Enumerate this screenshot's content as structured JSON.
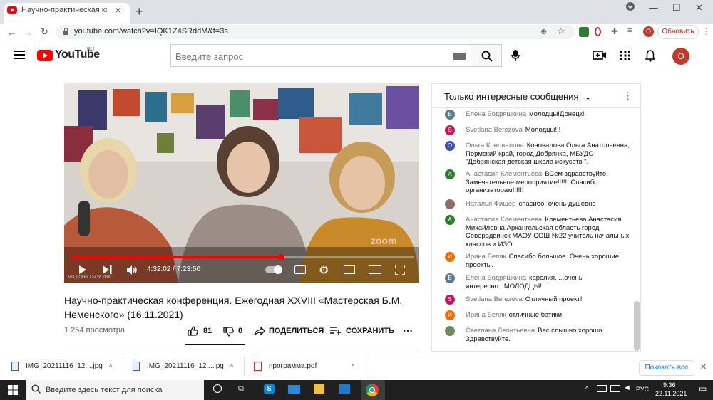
{
  "browser": {
    "tab_title": "Научно-практическая конфере",
    "url": "youtube.com/watch?v=IQK1Z4SRddM&t=3s",
    "update_label": "Обновить",
    "profile_initial": "О"
  },
  "youtube": {
    "logo_text": "YouTube",
    "region": "RU",
    "search_placeholder": "Введите запрос",
    "avatar_initial": "О"
  },
  "player": {
    "time_display": "4:32:02 / 7:23:50",
    "progress_fraction": 0.613,
    "watermark": "zoom",
    "corner_mark": "ГМЦ ДОНМ ГБОУ УНКО"
  },
  "video": {
    "title": "Научно-практическая конференция. Ежегодная XXVIII «Мастерская Б.М. Неменского» (16.11.2021)",
    "views": "1 254 просмотра",
    "likes": "81",
    "dislikes": "0",
    "share_label": "ПОДЕЛИТЬСЯ",
    "save_label": "СОХРАНИТЬ"
  },
  "chat": {
    "header": "Только интересные сообщения",
    "messages": [
      {
        "initial": "Е",
        "color": "#607d8b",
        "author": "Елена Бодряшкина",
        "text": "молодцы!Донецк!"
      },
      {
        "initial": "S",
        "color": "#c2185b",
        "author": "Svetlana Berezova",
        "text": "Молодцы!!!"
      },
      {
        "initial": "О",
        "color": "#3f51b5",
        "author": "Ольга Коновалова",
        "text": "Коновалова Ольга Анатольевна, Пермский край, город Добрянка, МБУДО \"Добрянская детская школа искусств \"."
      },
      {
        "initial": "А",
        "color": "#2e7d32",
        "author": "Анастасия Клементьева",
        "text": "ВСем здравствуйте. Замечательное мероприятие!!!!!! Спасибо организаторам!!!!!!"
      },
      {
        "initial": "",
        "color": "#8d6e63",
        "author": "Наталья Фишер",
        "text": "спасибо, очень душевно"
      },
      {
        "initial": "А",
        "color": "#2e7d32",
        "author": "Анастасия Клементьева",
        "text": "Клементьева Анастасия Михайловна Архангельская область город Северодвинск МАОУ СОШ №22 учитель начальных классов и ИЗО"
      },
      {
        "initial": "И",
        "color": "#ef6c00",
        "author": "Ирина Беляк",
        "text": "Спасибо большое. Очень хорошие проекты."
      },
      {
        "initial": "Е",
        "color": "#607d8b",
        "author": "Елена Бодряшкина",
        "text": "карелия, ...очень интересно...МОЛОДЦЫ!"
      },
      {
        "initial": "S",
        "color": "#c2185b",
        "author": "Svetlana Berezova",
        "text": "Отличный проект!"
      },
      {
        "initial": "И",
        "color": "#ef6c00",
        "author": "Ирина Беляк",
        "text": "отличные батики"
      },
      {
        "initial": "",
        "color": "#6d8b5e",
        "author": "Светлана Леонтьевна",
        "text": "Вас слышно хорошо. Здравствуйте."
      }
    ]
  },
  "downloads": {
    "items": [
      "IMG_20211116_12....jpg",
      "IMG_20211116_12....jpg",
      "программа.pdf"
    ],
    "show_all": "Показать все"
  },
  "taskbar": {
    "search_placeholder": "Введите здесь текст для поиска",
    "language": "РУС",
    "time": "9:36",
    "date": "22.11.2021"
  }
}
